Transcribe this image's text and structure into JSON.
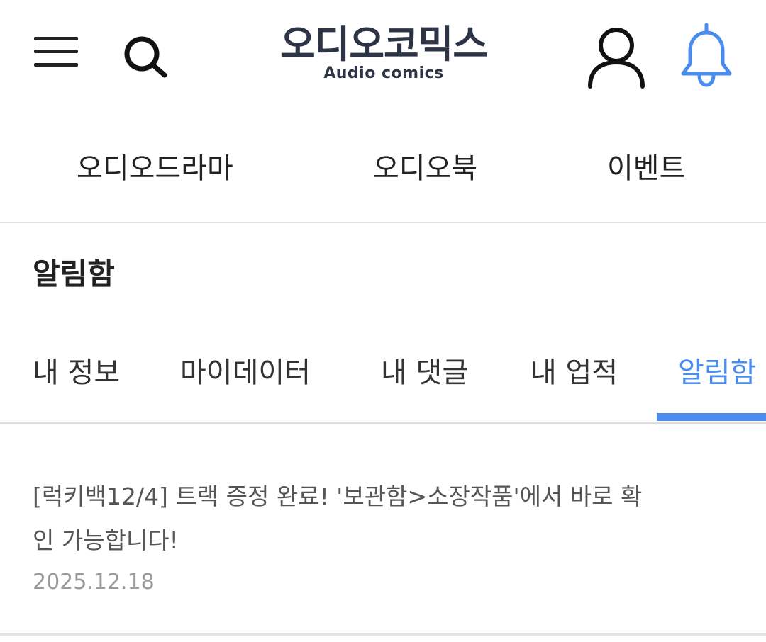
{
  "header": {
    "menu_icon": "hamburger-menu-icon",
    "search_icon": "search-icon",
    "logo": {
      "main": "오디오코믹스",
      "sub": "Audio comics"
    },
    "user_icon": "user-icon",
    "bell_icon": "bell-icon",
    "accent_color": "#4a8cf0",
    "logo_color": "#2d3446"
  },
  "category_nav": {
    "items": [
      {
        "label": "오디오드라마"
      },
      {
        "label": "오디오북"
      },
      {
        "label": "이벤트"
      }
    ]
  },
  "page": {
    "title": "알림함"
  },
  "tabs": {
    "items": [
      {
        "label": "내 정보",
        "active": false
      },
      {
        "label": "마이데이터",
        "active": false
      },
      {
        "label": "내 댓글",
        "active": false
      },
      {
        "label": "내 업적",
        "active": false
      },
      {
        "label": "알림함",
        "active": true
      }
    ]
  },
  "notifications": [
    {
      "message": "[럭키백12/4] 트랙 증정 완료! '보관함>소장작품'에서 바로 확인 가능합니다!",
      "date": "2025.12.18"
    }
  ]
}
